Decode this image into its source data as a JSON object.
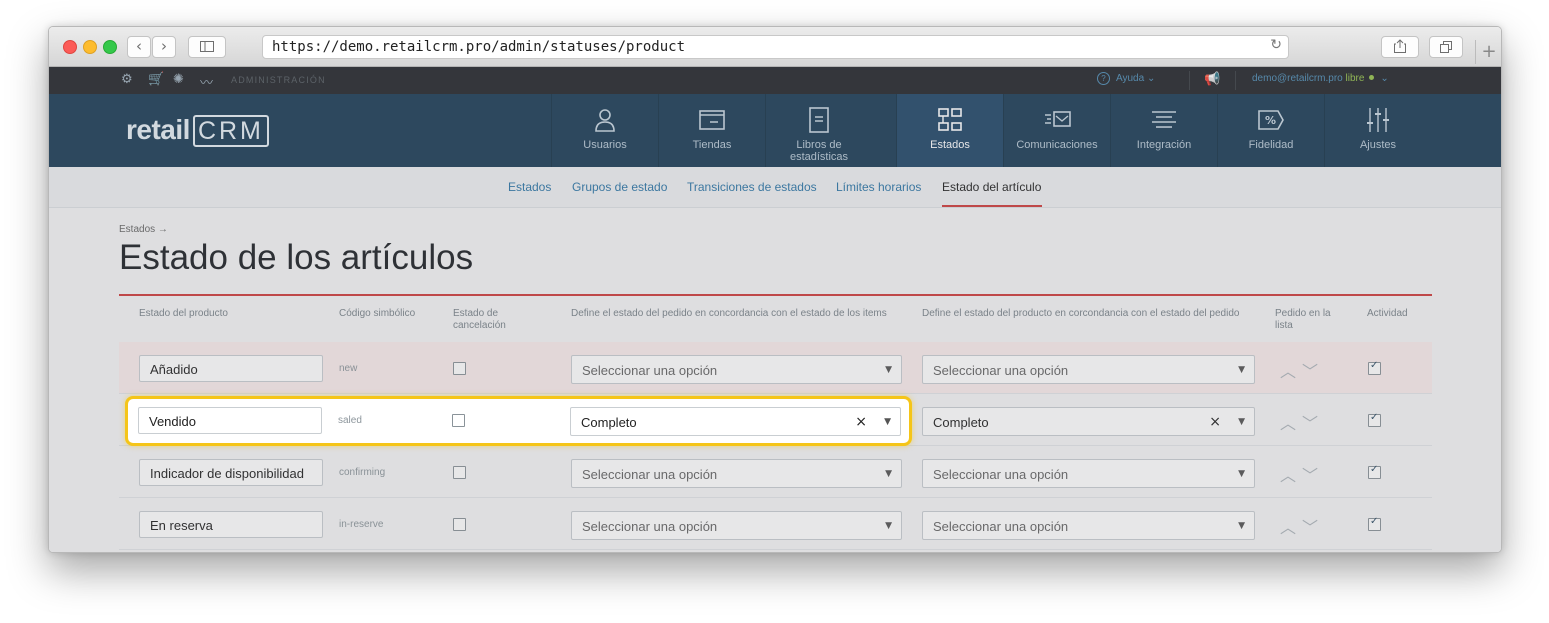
{
  "browser": {
    "url": "https://demo.retailcrm.pro/admin/statuses/product",
    "back_glyph": "‹",
    "forward_glyph": "›",
    "reload_glyph": "↻",
    "new_tab_glyph": "+"
  },
  "topbar": {
    "admin_label": "ADMINISTRACIÓN",
    "help_label": "Ayuda",
    "user_email": "demo@retailcrm.pro",
    "plan_label": "libre"
  },
  "logo": {
    "text": "retail",
    "crm": "CRM"
  },
  "nav": [
    {
      "label": "Usuarios",
      "icon": "user-icon"
    },
    {
      "label": "Tiendas",
      "icon": "store-icon"
    },
    {
      "label": "Libros de estadísticas",
      "icon": "book-icon"
    },
    {
      "label": "Estados",
      "icon": "statuses-icon"
    },
    {
      "label": "Comunicaciones",
      "icon": "communications-icon"
    },
    {
      "label": "Integración",
      "icon": "integration-icon"
    },
    {
      "label": "Fidelidad",
      "icon": "loyalty-icon"
    },
    {
      "label": "Ajustes",
      "icon": "sliders-icon"
    }
  ],
  "subnav": [
    "Estados",
    "Grupos de estado",
    "Transiciones de estados",
    "Límites horarios",
    "Estado del artículo"
  ],
  "breadcrumb": "Estados →",
  "title": "Estado de los artículos",
  "table": {
    "headers": {
      "name": "Estado del producto",
      "code": "Código simbólico",
      "cancel": "Estado de cancelación",
      "order_status": "Define el estado del pedido en concordancia con el estado de los items",
      "product_status": "Define el estado del producto en corcondancia con el estado del pedido",
      "order_list": "Pedido en la lista",
      "activity": "Actividad"
    },
    "placeholder": "Seleccionar una opción",
    "rows": [
      {
        "name": "Añadido",
        "code": "new",
        "order_status": "",
        "product_status": ""
      },
      {
        "name": "Vendido",
        "code": "saled",
        "order_status": "Completo",
        "product_status": "Completo"
      },
      {
        "name": "Indicador de disponibilidad",
        "code": "confirming",
        "order_status": "",
        "product_status": ""
      },
      {
        "name": "En reserva",
        "code": "in-reserve",
        "order_status": "",
        "product_status": ""
      }
    ]
  },
  "colors": {
    "header_bg": "#1d3e57",
    "accent_red": "#cf3d3d",
    "link_blue": "#2f77a8",
    "highlight": "#f5c518"
  }
}
